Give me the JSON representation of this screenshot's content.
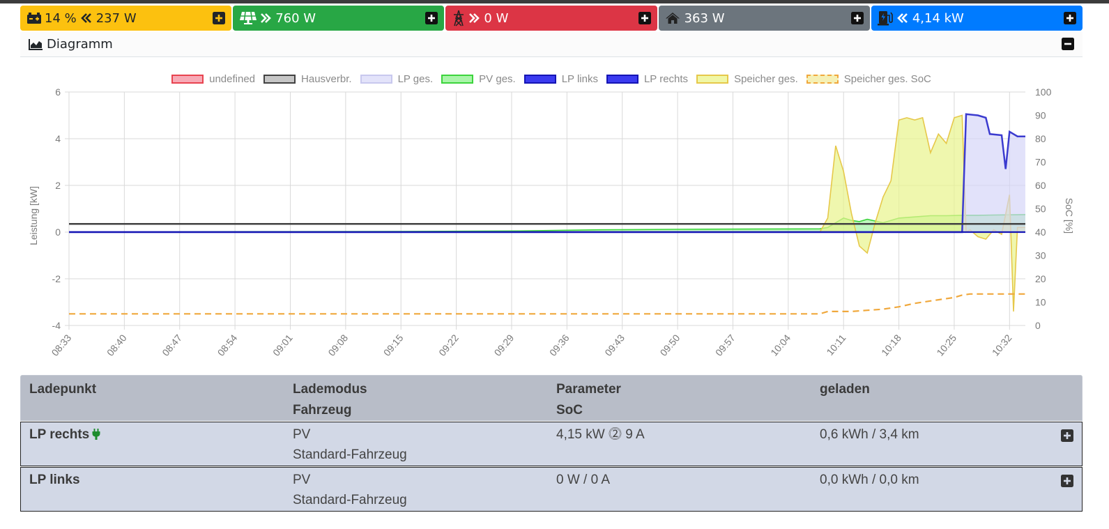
{
  "tiles": [
    {
      "name": "battery",
      "icon": "car-battery-icon",
      "direction": "discharge",
      "percent": "14 %",
      "value": "237 W",
      "color": "#fcc10f"
    },
    {
      "name": "pv",
      "icon": "solar-panel-icon",
      "direction": "export",
      "value": "760 W",
      "color": "#28a745"
    },
    {
      "name": "grid",
      "icon": "power-pylon-icon",
      "direction": "export",
      "value": "0 W",
      "color": "#dc3545"
    },
    {
      "name": "house",
      "icon": "home-icon",
      "value": "363 W",
      "color": "#6c757d"
    },
    {
      "name": "chargepoints",
      "icon": "charging-station-icon",
      "direction": "import",
      "value": "4,14 kW",
      "color": "#007bff"
    }
  ],
  "diagram": {
    "title": "Diagramm",
    "icon": "area-chart-icon",
    "expanded": true
  },
  "chart_data": {
    "type": "line",
    "legend_position": "top",
    "grid": true,
    "legend": [
      {
        "label": "undefined",
        "fill": "#f7aab6",
        "stroke": "#e8434f",
        "dashed": false
      },
      {
        "label": "Hausverbr.",
        "fill": "#c6c6c6",
        "stroke": "#424242",
        "dashed": false
      },
      {
        "label": "LP ges.",
        "fill": "#e3e3fa",
        "stroke": "#c8c8ee",
        "dashed": false
      },
      {
        "label": "PV ges.",
        "fill": "#a9f5a9",
        "stroke": "#3cd43c",
        "dashed": false
      },
      {
        "label": "LP links",
        "fill": "#3b3bf0",
        "stroke": "#1414b4",
        "dashed": false
      },
      {
        "label": "LP rechts",
        "fill": "#3b3bf0",
        "stroke": "#1414b4",
        "dashed": false
      },
      {
        "label": "Speicher ges.",
        "fill": "#f0f7a6",
        "stroke": "#e6c84a",
        "dashed": false
      },
      {
        "label": "Speicher ges. SoC",
        "fill": "#f5f0b5",
        "stroke": "#f0a83c",
        "dashed": true
      }
    ],
    "x_labels": [
      "08:33",
      "08:40",
      "08:47",
      "08:54",
      "09:01",
      "09:08",
      "09:15",
      "09:22",
      "09:29",
      "09:36",
      "09:43",
      "09:50",
      "09:57",
      "10:04",
      "10:11",
      "10:18",
      "10:25",
      "10:32"
    ],
    "x_range_minutes": [
      513,
      634
    ],
    "y_left": {
      "label": "Leistung [kW]",
      "ticks": [
        6,
        4,
        2,
        0,
        -2,
        -4
      ],
      "range": [
        -4,
        6
      ]
    },
    "y_right": {
      "label": "SoC [%]",
      "ticks": [
        100,
        90,
        80,
        70,
        60,
        50,
        40,
        30,
        20,
        10,
        0
      ],
      "range": [
        0,
        100
      ]
    },
    "series": [
      {
        "name": "Hausverbr.",
        "axis": "left",
        "type": "line",
        "color": "#424242",
        "points": [
          [
            513,
            0.35
          ],
          [
            634,
            0.35
          ]
        ]
      },
      {
        "name": "PV ges.",
        "axis": "left",
        "type": "area",
        "color": "#3cd43c",
        "fill": "rgba(140,240,140,0.55)",
        "points": [
          [
            513,
            0
          ],
          [
            540,
            0.02
          ],
          [
            555,
            0.03
          ],
          [
            570,
            0.05
          ],
          [
            580,
            0.1
          ],
          [
            590,
            0.12
          ],
          [
            600,
            0.13
          ],
          [
            608,
            0.14
          ],
          [
            609,
            0.2
          ],
          [
            610,
            0.4
          ],
          [
            611,
            0.6
          ],
          [
            612,
            0.5
          ],
          [
            613,
            0.45
          ],
          [
            614,
            0.55
          ],
          [
            616,
            0.4
          ],
          [
            618,
            0.6
          ],
          [
            620,
            0.65
          ],
          [
            622,
            0.7
          ],
          [
            624,
            0.7
          ],
          [
            626,
            0.72
          ],
          [
            628,
            0.72
          ],
          [
            630,
            0.73
          ],
          [
            634,
            0.75
          ]
        ]
      },
      {
        "name": "Speicher ges.",
        "axis": "left",
        "type": "area",
        "color": "#e6c84a",
        "fill": "rgba(232,244,140,0.7)",
        "points": [
          [
            513,
            0
          ],
          [
            608,
            0
          ],
          [
            609,
            0.6
          ],
          [
            610,
            3.7
          ],
          [
            611,
            2.6
          ],
          [
            612,
            0.8
          ],
          [
            613,
            -0.6
          ],
          [
            614,
            -0.9
          ],
          [
            615,
            0.4
          ],
          [
            616,
            1.5
          ],
          [
            617,
            2.2
          ],
          [
            618,
            4.8
          ],
          [
            619,
            4.9
          ],
          [
            620,
            4.8
          ],
          [
            621,
            4.9
          ],
          [
            622,
            3.4
          ],
          [
            623,
            4.2
          ],
          [
            624,
            3.8
          ],
          [
            625,
            4.9
          ],
          [
            626,
            5.0
          ],
          [
            626.5,
            0
          ],
          [
            627,
            0.1
          ],
          [
            628,
            -0.2
          ],
          [
            629,
            -0.3
          ],
          [
            630,
            0.1
          ],
          [
            631,
            -0.1
          ],
          [
            632,
            1.6
          ],
          [
            632.5,
            -3.4
          ],
          [
            633,
            0.2
          ],
          [
            634,
            0.2
          ]
        ]
      },
      {
        "name": "LP ges.",
        "axis": "left",
        "type": "area",
        "color": "#3b3bcf",
        "fill": "rgba(210,210,248,0.65)",
        "points": [
          [
            513,
            0
          ],
          [
            626,
            0
          ],
          [
            626.5,
            5.05
          ],
          [
            628,
            5.0
          ],
          [
            629,
            4.9
          ],
          [
            629.5,
            4.2
          ],
          [
            631,
            4.15
          ],
          [
            631.5,
            2.7
          ],
          [
            632,
            4.3
          ],
          [
            633,
            4.1
          ],
          [
            634,
            4.1
          ]
        ]
      },
      {
        "name": "LP links",
        "axis": "left",
        "type": "line",
        "color": "#1414b4",
        "points": [
          [
            513,
            0
          ],
          [
            634,
            0
          ]
        ]
      },
      {
        "name": "Speicher ges. SoC",
        "axis": "right",
        "type": "line",
        "dashed": true,
        "color": "#f0a83c",
        "points": [
          [
            513,
            5
          ],
          [
            608,
            5
          ],
          [
            609,
            6
          ],
          [
            612,
            6
          ],
          [
            614,
            6.5
          ],
          [
            616,
            7
          ],
          [
            618,
            8
          ],
          [
            620,
            9.5
          ],
          [
            621,
            10
          ],
          [
            623,
            11
          ],
          [
            625,
            12
          ],
          [
            626,
            13
          ],
          [
            627,
            13.5
          ],
          [
            634,
            13.5
          ]
        ]
      }
    ]
  },
  "table": {
    "headers": {
      "col1": "Ladepunkt",
      "col2a": "Lademodus",
      "col2b": "Fahrzeug",
      "col3a": "Parameter",
      "col3b": "SoC",
      "col4": "geladen"
    },
    "rows": [
      {
        "name": "LP rechts",
        "plugged": true,
        "mode": "PV",
        "vehicle": "Standard-Fahrzeug",
        "params": "4,15 kW ⓶ 9 A",
        "charged": "0,6 kWh / 3,4 km"
      },
      {
        "name": "LP links",
        "plugged": false,
        "mode": "PV",
        "vehicle": "Standard-Fahrzeug",
        "params": "0 W / 0 A",
        "charged": "0,0 kWh / 0,0 km"
      }
    ]
  }
}
